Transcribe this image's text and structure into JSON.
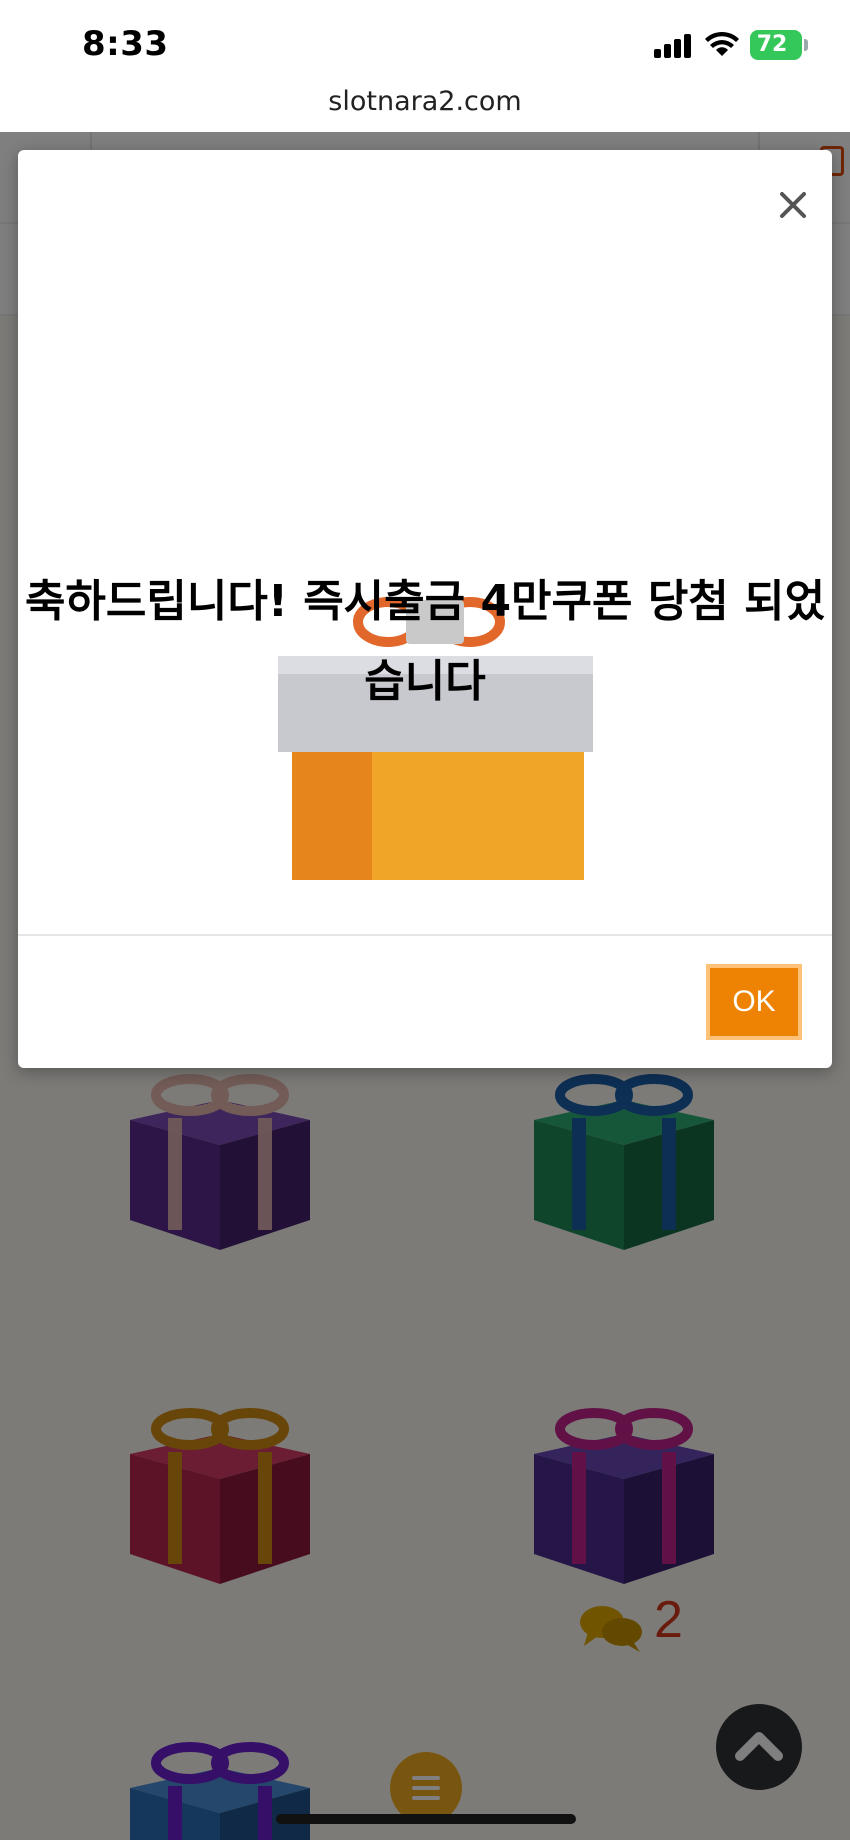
{
  "status_bar": {
    "time": "8:33",
    "battery": "72",
    "icons": [
      "signal-icon",
      "wifi-icon",
      "battery-icon"
    ]
  },
  "browser": {
    "url": "slotnara2.com"
  },
  "page": {
    "chat": {
      "count": "2",
      "icon": "chat-bubbles-icon"
    },
    "gifts": [
      {
        "color": "#5b2d8f",
        "ribbon": "#e6b8b0"
      },
      {
        "color": "#1f8a57",
        "ribbon": "#1a5fa8"
      },
      {
        "color": "#b8244f",
        "ribbon": "#d18a12"
      },
      {
        "color": "#4a2c8f",
        "ribbon": "#c2238c"
      },
      {
        "color": "#2d6fb8",
        "ribbon": "#6a1fd1"
      }
    ]
  },
  "modal": {
    "message": "축하드립니다! 즉시출금 4만쿠폰 당첨 되었습니다",
    "ok_label": "OK",
    "close_icon": "close-icon",
    "accent_color": "#ee8203"
  }
}
